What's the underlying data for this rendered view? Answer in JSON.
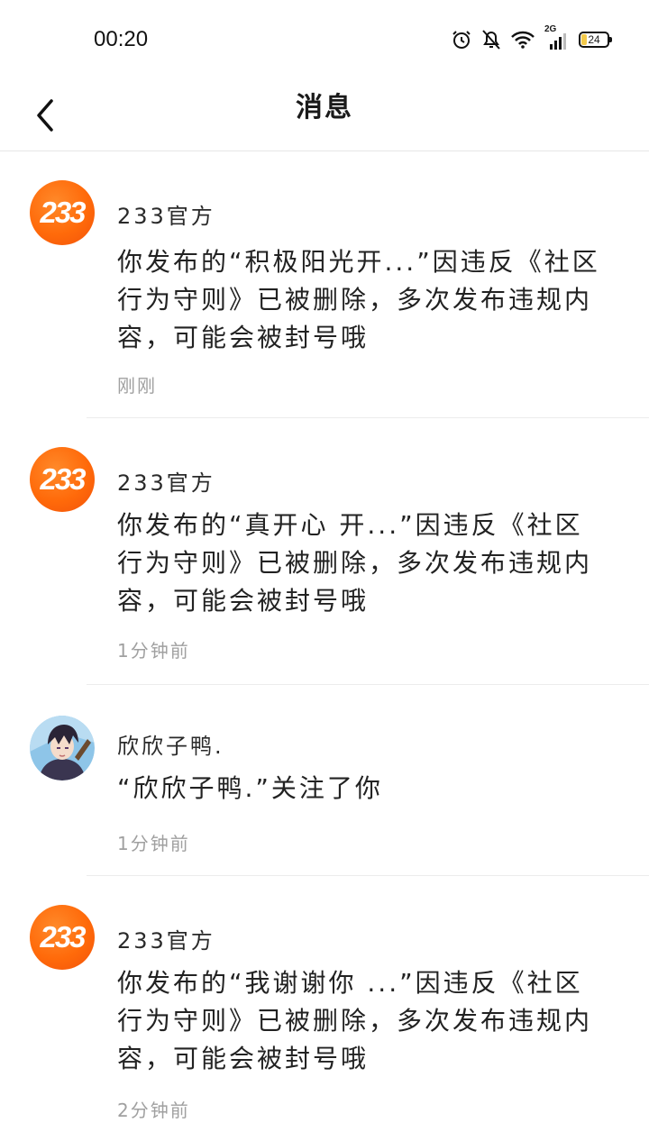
{
  "status_bar": {
    "time": "00:20",
    "network": "2G",
    "battery": "24"
  },
  "header": {
    "title": "消息"
  },
  "messages": [
    {
      "avatar": "233",
      "sender": "233官方",
      "text": "你发布的“积极阳光开...”因违反《社区行为守则》已被删除，多次发布违规内容，可能会被封号哦",
      "time": "刚刚"
    },
    {
      "avatar": "233",
      "sender": "233官方",
      "text": "你发布的“真开心 开...”因违反《社区行为守则》已被删除，多次发布违规内容，可能会被封号哦",
      "time": "1分钟前"
    },
    {
      "avatar": "anime-character-avatar",
      "sender": "欣欣子鸭.",
      "text": "“欣欣子鸭.”关注了你",
      "time": "1分钟前"
    },
    {
      "avatar": "233",
      "sender": "233官方",
      "text": "你发布的“我谢谢你 ...”因违反《社区行为守则》已被删除，多次发布违规内容，可能会被封号哦",
      "time": "2分钟前"
    }
  ],
  "colors": {
    "brand_orange": "#ff6a0a",
    "timestamp_gray": "#a0a0a0",
    "divider": "#ececec"
  }
}
